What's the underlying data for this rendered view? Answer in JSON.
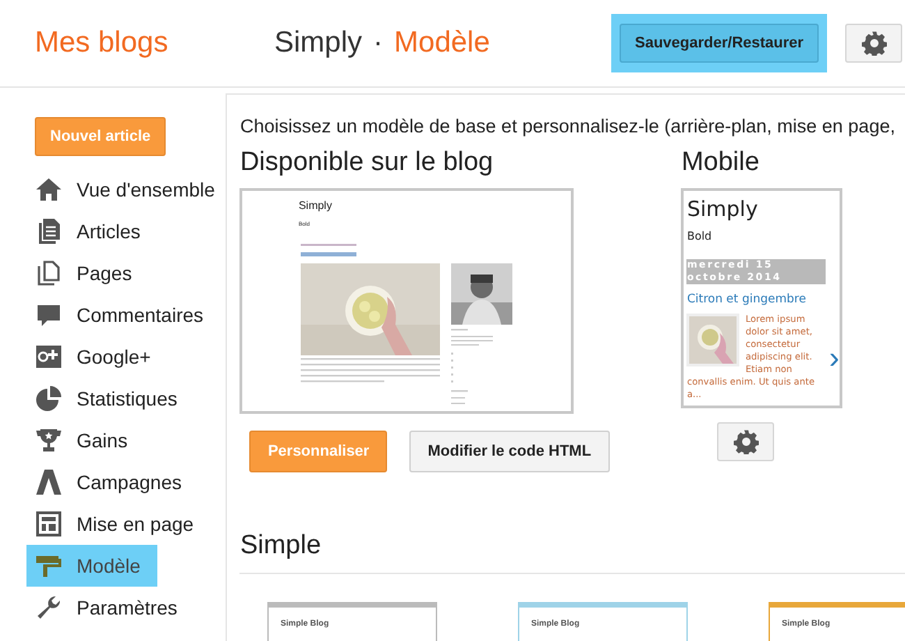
{
  "header": {
    "title": "Mes blogs",
    "blog_name": "Simply",
    "separator": "·",
    "page": "Modèle",
    "save_button": "Sauvegarder/Restaurer"
  },
  "sidebar": {
    "new_post": "Nouvel article",
    "items": [
      {
        "label": "Vue d'ensemble",
        "selected": false
      },
      {
        "label": "Articles",
        "selected": false
      },
      {
        "label": "Pages",
        "selected": false
      },
      {
        "label": "Commentaires",
        "selected": false
      },
      {
        "label": "Google+",
        "selected": false
      },
      {
        "label": "Statistiques",
        "selected": false
      },
      {
        "label": "Gains",
        "selected": false
      },
      {
        "label": "Campagnes",
        "selected": false
      },
      {
        "label": "Mise en page",
        "selected": false
      },
      {
        "label": "Modèle",
        "selected": true
      },
      {
        "label": "Paramètres",
        "selected": false
      }
    ]
  },
  "intro": "Choisissez un modèle de base et personnalisez-le (arrière-plan, mise en page,",
  "live": {
    "heading": "Disponible sur le blog",
    "preview": {
      "title": "Simply",
      "subtitle": "Bold"
    },
    "customize_button": "Personnaliser",
    "edit_html_button": "Modifier le code HTML"
  },
  "mobile": {
    "heading": "Mobile",
    "preview": {
      "title": "Simply",
      "subtitle": "Bold",
      "date": "mercredi 15 octobre 2014",
      "post_title": "Citron et gingembre",
      "excerpt_beside": "Lorem ipsum dolor sit amet, consectetur adipiscing elit. Etiam non",
      "excerpt_below": "convallis enim. Ut quis ante a...",
      "next": "›"
    }
  },
  "simple": {
    "heading": "Simple",
    "thumbnails": [
      {
        "title": "Simple Blog",
        "color": "#bbbbbb"
      },
      {
        "title": "Simple Blog",
        "color": "#9fd3e8"
      },
      {
        "title": "Simple Blog",
        "color": "#e8a73a"
      }
    ]
  }
}
